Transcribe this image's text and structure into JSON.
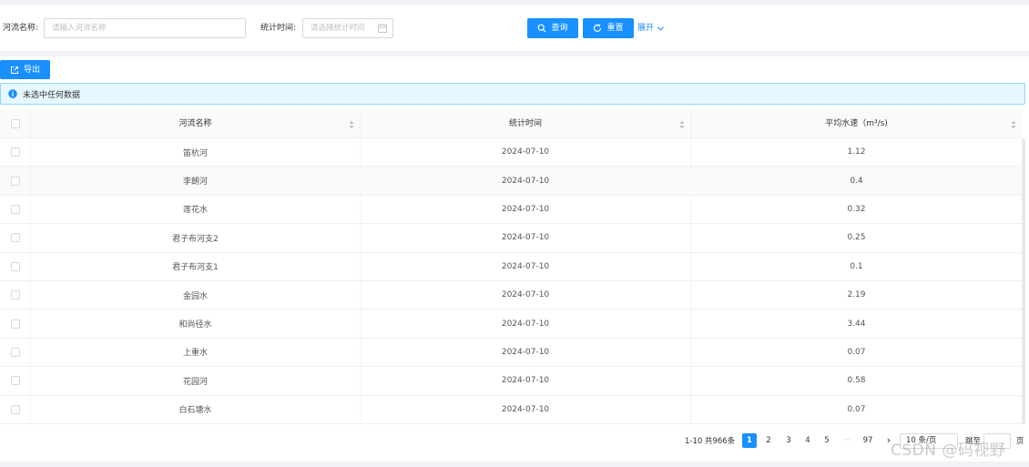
{
  "search": {
    "river_name_label": "河流名称:",
    "river_name_placeholder": "请输入河流名称",
    "stat_time_label": "统计时间:",
    "stat_time_placeholder": "请选择统计时间",
    "query_label": "查询",
    "reset_label": "重置",
    "expand_label": "展开"
  },
  "toolbar": {
    "export_label": "导出"
  },
  "alert": {
    "text": "未选中任何数据"
  },
  "table": {
    "columns": [
      "河流名称",
      "统计时间",
      "平均水速（m³/s)"
    ],
    "rows": [
      {
        "name": "笛杭河",
        "date": "2024-07-10",
        "speed": "1.12"
      },
      {
        "name": "李朗河",
        "date": "2024-07-10",
        "speed": "0.4"
      },
      {
        "name": "莲花水",
        "date": "2024-07-10",
        "speed": "0.32"
      },
      {
        "name": "君子布河支2",
        "date": "2024-07-10",
        "speed": "0.25"
      },
      {
        "name": "君子布河支1",
        "date": "2024-07-10",
        "speed": "0.1"
      },
      {
        "name": "金园水",
        "date": "2024-07-10",
        "speed": "2.19"
      },
      {
        "name": "和尚径水",
        "date": "2024-07-10",
        "speed": "3.44"
      },
      {
        "name": "上重水",
        "date": "2024-07-10",
        "speed": "0.07"
      },
      {
        "name": "花园河",
        "date": "2024-07-10",
        "speed": "0.58"
      },
      {
        "name": "白石塘水",
        "date": "2024-07-10",
        "speed": "0.07"
      }
    ]
  },
  "pagination": {
    "total_text": "1-10 共966条",
    "pages": [
      "1",
      "2",
      "3",
      "4",
      "5"
    ],
    "ellipsis": "···",
    "last_page": "97",
    "next": "›",
    "page_size": "10 条/页",
    "jump_label": "跳至",
    "jump_suffix": "页",
    "current_page": "1"
  },
  "watermark": "CSDN @码视野",
  "colors": {
    "primary": "#1890ff",
    "alert_bg": "#e6f7ff",
    "alert_border": "#91d5ff"
  }
}
